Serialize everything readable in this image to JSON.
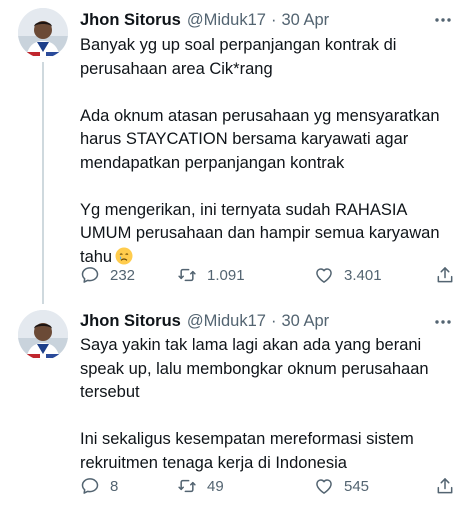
{
  "tweets": [
    {
      "author": {
        "name": "Jhon Sitorus",
        "handle": "@Miduk17",
        "separator": "·"
      },
      "date": "30 Apr",
      "lines": [
        [
          "Banyak yg up soal perpanjangan kontrak di",
          "perusahaan area Cik*rang"
        ],
        [
          "Ada oknum atasan perusahaan yg mensyaratkan",
          "harus STAYCATION bersama karyawati agar",
          "mendapatkan perpanjangan kontrak"
        ],
        [
          "Yg mengerikan, ini ternyata sudah RAHASIA",
          "UMUM perusahaan dan hampir semua karyawan",
          "tahu"
        ]
      ],
      "trailing_emoji": "crying-face-icon",
      "stats": {
        "replies": "232",
        "retweets": "1.091",
        "likes": "3.401"
      }
    },
    {
      "author": {
        "name": "Jhon Sitorus",
        "handle": "@Miduk17",
        "separator": "·"
      },
      "date": "30 Apr",
      "lines": [
        [
          "Saya yakin tak lama lagi akan ada yang berani",
          "speak up, lalu membongkar oknum perusahaan",
          "tersebut"
        ],
        [
          "Ini sekaligus kesempatan mereformasi sistem",
          "rekruitmen tenaga kerja di Indonesia"
        ]
      ],
      "stats": {
        "replies": "8",
        "retweets": "49",
        "likes": "545"
      }
    }
  ],
  "icons": {
    "more": "more-horizontal-icon",
    "reply": "reply-icon",
    "retweet": "retweet-icon",
    "like": "heart-icon",
    "share": "share-icon"
  },
  "colors": {
    "text": "#0f1419",
    "secondary": "#536471",
    "thread_line": "#cfd9de"
  }
}
